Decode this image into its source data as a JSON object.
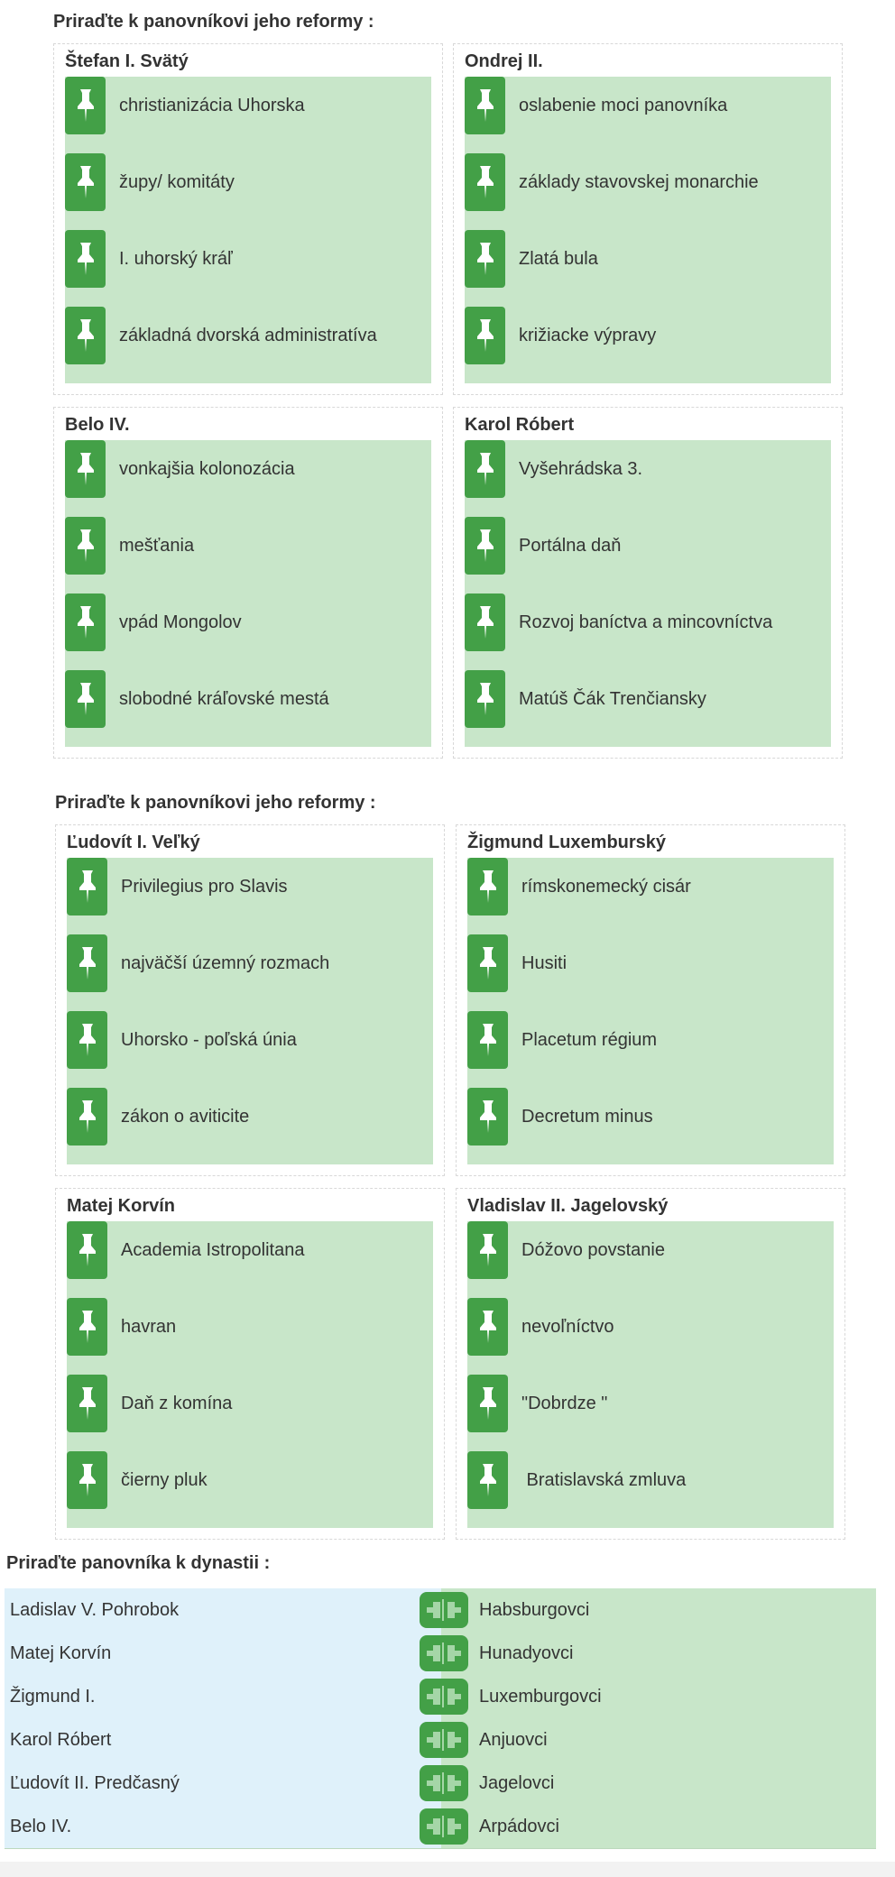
{
  "section1": {
    "title": "Priraďte k panovníkovi jeho reformy :",
    "groups": [
      {
        "name": "Štefan I. Svätý",
        "items": [
          "christianizácia Uhorska",
          "župy/ komitáty",
          "I. uhorský kráľ",
          "základná dvorská administratíva"
        ]
      },
      {
        "name": "Ondrej II.",
        "items": [
          "oslabenie moci panovníka",
          "základy stavovskej monarchie",
          "Zlatá bula",
          "križiacke výpravy"
        ]
      },
      {
        "name": "Belo IV.",
        "items": [
          "vonkajšia kolonozácia",
          "mešťania",
          "vpád Mongolov",
          "slobodné kráľovské mestá"
        ]
      },
      {
        "name": "Karol Róbert",
        "items": [
          "Vyšehrádska 3.",
          "Portálna daň",
          "Rozvoj baníctva a mincovníctva",
          "Matúš Čák Trenčiansky"
        ]
      }
    ]
  },
  "section2": {
    "title": "Priraďte k panovníkovi jeho reformy :",
    "groups": [
      {
        "name": "Ľudovít I. Veľký",
        "items": [
          "Privilegius pro Slavis",
          "najväčší územný rozmach",
          "Uhorsko - poľská únia",
          "zákon o aviticite"
        ]
      },
      {
        "name": "Žigmund Luxemburský",
        "items": [
          "rímskonemecký cisár",
          "Husiti",
          "Placetum régium",
          "Decretum minus"
        ]
      },
      {
        "name": "Matej Korvín",
        "items": [
          "Academia Istropolitana",
          "havran",
          "Daň z komína",
          "čierny pluk"
        ]
      },
      {
        "name": "Vladislav II. Jagelovský",
        "items": [
          "Dóžovo povstanie",
          "nevoľníctvo",
          "\"Dobrdze \"",
          " Bratislavská zmluva"
        ]
      }
    ]
  },
  "section3": {
    "title": "Priraďte panovníka k dynastii :",
    "pairs": [
      {
        "left": "Ladislav V. Pohrobok",
        "right": "Habsburgovci"
      },
      {
        "left": "Matej Korvín",
        "right": "Hunadyovci"
      },
      {
        "left": "Žigmund I.",
        "right": "Luxemburgovci"
      },
      {
        "left": "Karol Róbert",
        "right": "Anjuovci"
      },
      {
        "left": "Ľudovít II. Predčasný",
        "right": "Jagelovci"
      },
      {
        "left": "Belo IV.",
        "right": "Arpádovci"
      }
    ]
  },
  "icons": {
    "pin": "pin-icon",
    "plug": "plug-icon"
  },
  "colors": {
    "pin_green": "#43a047",
    "drop_zone": "#c8e6c9",
    "left_column": "#dff1fa"
  }
}
